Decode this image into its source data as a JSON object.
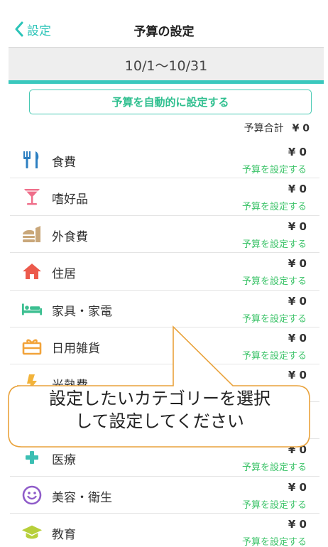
{
  "nav": {
    "back_label": "設定",
    "title": "予算の設定"
  },
  "period": "10/1〜10/31",
  "auto_button": "予算を自動的に設定する",
  "total": {
    "label": "予算合計",
    "amount": "¥ 0"
  },
  "categories": [
    {
      "name": "食費",
      "icon": "utensils-icon",
      "color": "#2d7fc1",
      "amount": "¥ 0",
      "set_label": "予算を設定する"
    },
    {
      "name": "嗜好品",
      "icon": "cocktail-icon",
      "color": "#ef6e8a",
      "amount": "¥ 0",
      "set_label": "予算を設定する"
    },
    {
      "name": "外食費",
      "icon": "burger-icon",
      "color": "#c9a77a",
      "amount": "¥ 0",
      "set_label": "予算を設定する"
    },
    {
      "name": "住居",
      "icon": "house-icon",
      "color": "#ec5a4c",
      "amount": "¥ 0",
      "set_label": "予算を設定する"
    },
    {
      "name": "家具・家電",
      "icon": "bed-icon",
      "color": "#3cbf91",
      "amount": "¥ 0",
      "set_label": "予算を設定する"
    },
    {
      "name": "日用雑貨",
      "icon": "gift-box-icon",
      "color": "#f2a33a",
      "amount": "¥ 0",
      "set_label": "予算を設定する"
    },
    {
      "name": "光熱費",
      "icon": "bolt-icon",
      "color": "#f2b33a",
      "amount": "¥ 0",
      "set_label": "予算を設定する"
    },
    {
      "name": "",
      "icon": "hidden-icon",
      "color": "#999999",
      "amount": "",
      "set_label": ""
    },
    {
      "name": "医療",
      "icon": "cross-icon",
      "color": "#3cbfb3",
      "amount": "¥ 0",
      "set_label": "予算を設定する"
    },
    {
      "name": "美容・衛生",
      "icon": "smile-icon",
      "color": "#8f5cc9",
      "amount": "¥ 0",
      "set_label": "予算を設定する"
    },
    {
      "name": "教育",
      "icon": "graduation-cap-icon",
      "color": "#b7cf3a",
      "amount": "¥ 0",
      "set_label": "予算を設定する"
    }
  ],
  "callout": {
    "line1": "設定したいカテゴリーを選択",
    "line2": "して設定してください"
  }
}
